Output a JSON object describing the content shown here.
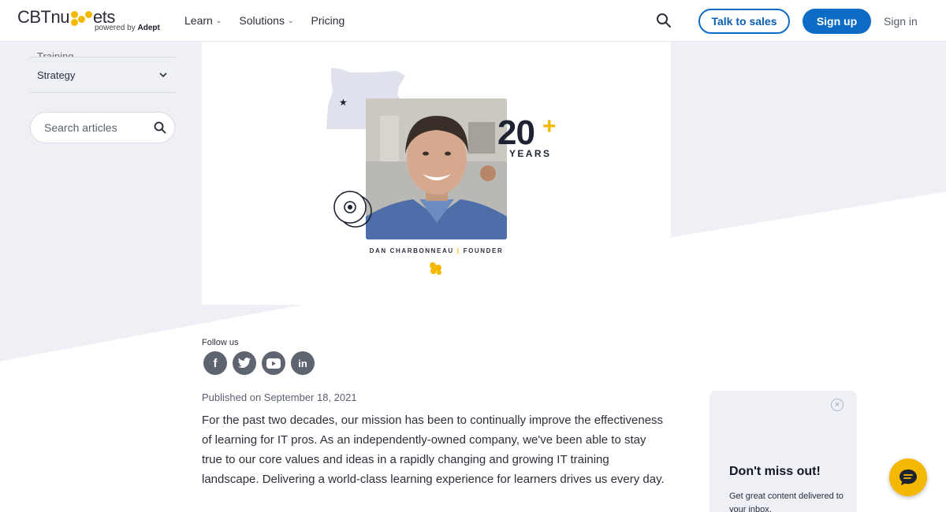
{
  "header": {
    "logo_main": "CBTnuggets",
    "logo_prefix": "CBTnu",
    "logo_suffix": "ets",
    "logo_powered": "powered by",
    "logo_brand": "Adept",
    "nav": [
      {
        "label": "Learn"
      },
      {
        "label": "Solutions"
      },
      {
        "label": "Pricing"
      }
    ],
    "talk_to_sales": "Talk to sales",
    "sign_up": "Sign up",
    "sign_in": "Sign in"
  },
  "sidebar": {
    "items": [
      {
        "label": "Training"
      },
      {
        "label": "Strategy"
      }
    ],
    "search_placeholder": "Search articles"
  },
  "hero": {
    "years_number": "20",
    "years_plus": "+",
    "years_word": "YEARS",
    "founder_name": "DAN CHARBONNEAU",
    "founder_role": "FOUNDER"
  },
  "follow": {
    "label": "Follow us",
    "networks": [
      "facebook",
      "twitter",
      "youtube",
      "linkedin"
    ]
  },
  "article": {
    "published": "Published on September 18, 2021",
    "body": "For the past two decades, our mission has been to continually improve the effectiveness of learning for IT pros. As an independently-owned company, we've been able to stay true to our core values and ideas in a rapidly changing and growing IT training landscape. Delivering a world-class learning experience for learners drives us every day."
  },
  "promo": {
    "title": "Don't miss out!",
    "text": "Get great content delivered to your inbox."
  },
  "colors": {
    "brand_blue": "#0c6bc4",
    "brand_yellow": "#f5b800",
    "background_gray": "#eef0f6"
  }
}
